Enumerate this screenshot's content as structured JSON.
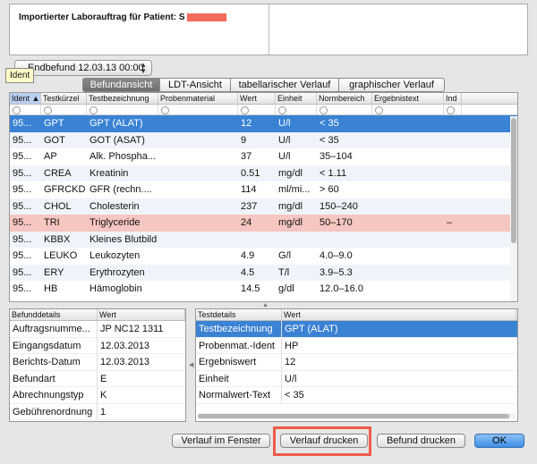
{
  "header": {
    "title": "Importierter Laborauftrag für Patient: S"
  },
  "tooltip": {
    "text": "Ident"
  },
  "report_select": {
    "value": "Endbefund 12.03.13 00:00"
  },
  "tabs": [
    {
      "label": "Befundansicht",
      "active": true
    },
    {
      "label": "LDT-Ansicht",
      "active": false
    },
    {
      "label": "tabellarischer Verlauf",
      "active": false
    },
    {
      "label": "graphischer Verlauf",
      "active": false
    }
  ],
  "table": {
    "columns": [
      "Ident",
      "Testkürzel",
      "Testbezeichnung",
      "Probenmaterial",
      "Wert",
      "Einheit",
      "Normbereich",
      "Ergebnistext",
      "Ind"
    ],
    "rows": [
      [
        "95...",
        "GPT",
        "GPT (ALAT)",
        "",
        "12",
        "U/l",
        "< 35",
        "",
        ""
      ],
      [
        "95...",
        "GOT",
        "GOT (ASAT)",
        "",
        "9",
        "U/l",
        "< 35",
        "",
        ""
      ],
      [
        "95...",
        "AP",
        "Alk. Phospha...",
        "",
        "37",
        "U/l",
        "35–104",
        "",
        ""
      ],
      [
        "95...",
        "CREA",
        "Kreatinin",
        "",
        "0.51",
        "mg/dl",
        "< 1.11",
        "",
        ""
      ],
      [
        "95...",
        "GFRCKD",
        "GFR (rechn....",
        "",
        "114",
        "ml/mi...",
        "> 60",
        "",
        ""
      ],
      [
        "95...",
        "CHOL",
        "Cholesterin",
        "",
        "237",
        "mg/dl",
        "150–240",
        "",
        ""
      ],
      [
        "95...",
        "TRI",
        "Triglyceride",
        "",
        "24",
        "mg/dl",
        "50–170",
        "",
        "–"
      ],
      [
        "95...",
        "KBBX",
        "Kleines Blutbild",
        "",
        "",
        "",
        "",
        "",
        ""
      ],
      [
        "95...",
        "LEUKO",
        "Leukozyten",
        "",
        "4.9",
        "G/l",
        "4.0–9.0",
        "",
        ""
      ],
      [
        "95...",
        "ERY",
        "Erythrozyten",
        "",
        "4.5",
        "T/l",
        "3.9–5.3",
        "",
        ""
      ],
      [
        "95...",
        "HB",
        "Hämoglobin",
        "",
        "14.5",
        "g/dl",
        "12.0–16.0",
        "",
        ""
      ]
    ]
  },
  "befund_details": {
    "columns": [
      "Befunddetails",
      "Wert"
    ],
    "rows": [
      [
        "Auftragsnumme...",
        "JP NC12 1311"
      ],
      [
        "Eingangsdatum",
        "12.03.2013"
      ],
      [
        "Berichts-Datum",
        "12.03.2013"
      ],
      [
        "Befundart",
        "E"
      ],
      [
        "Abrechnungstyp",
        "K"
      ],
      [
        "Gebührenordnung",
        "1"
      ]
    ]
  },
  "test_details": {
    "columns": [
      "Testdetails",
      "Wert"
    ],
    "rows": [
      [
        "Testbezeichnung",
        "GPT (ALAT)"
      ],
      [
        "Probenmat.-Ident",
        "HP"
      ],
      [
        "Ergebniswert",
        "12"
      ],
      [
        "Einheit",
        "U/l"
      ],
      [
        "Normalwert-Text",
        "< 35"
      ]
    ]
  },
  "buttons": {
    "verlauf_fenster": "Verlauf im Fenster",
    "verlauf_drucken": "Verlauf drucken",
    "befund_drucken": "Befund drucken",
    "ok": "OK"
  },
  "colors": {
    "selection": "#3a82d4",
    "flagged_row": "#f6c6c0",
    "redaction": "#f26a5c",
    "callout": "#ee5b4a"
  }
}
